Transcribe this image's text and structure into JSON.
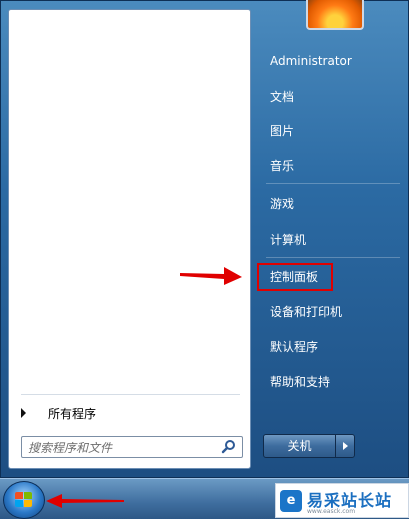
{
  "start_menu": {
    "all_programs_label": "所有程序",
    "search_placeholder": "搜索程序和文件",
    "right_pane": {
      "user_name": "Administrator",
      "items": [
        {
          "label": "文档"
        },
        {
          "label": "图片"
        },
        {
          "label": "音乐"
        },
        {
          "label": "游戏"
        },
        {
          "label": "计算机"
        },
        {
          "label": "控制面板"
        },
        {
          "label": "设备和打印机"
        },
        {
          "label": "默认程序"
        },
        {
          "label": "帮助和支持"
        }
      ]
    },
    "shutdown_label": "关机"
  },
  "watermark": {
    "name": "易采站长站",
    "url": "www.easck.com"
  },
  "colors": {
    "highlight": "#e00000",
    "arrow": "#e00000"
  }
}
